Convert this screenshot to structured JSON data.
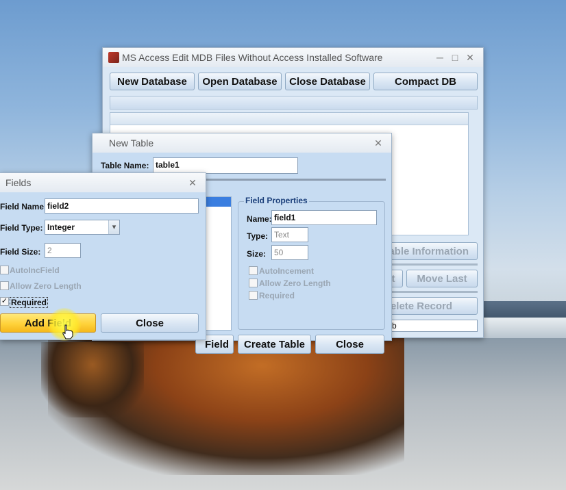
{
  "main_window": {
    "title": "MS Access Edit MDB Files Without Access Installed Software",
    "buttons": {
      "new_database": "New Database",
      "open_database": "Open Database",
      "close_database": "Close Database",
      "compact_db": "Compact DB"
    },
    "partial_buttons": {
      "table_information": "able Information",
      "prev": "t",
      "move_last": "Move Last",
      "delete_record": "elete Record"
    },
    "status_field": "b"
  },
  "new_table_window": {
    "title": "New Table",
    "table_name_label": "Table Name:",
    "table_name_value": "table1",
    "field_properties": {
      "title": "Field Properties",
      "name_label": "Name:",
      "name_value": "field1",
      "type_label": "Type:",
      "type_value": "Text",
      "size_label": "Size:",
      "size_value": "50",
      "autoincrement": "AutoIncement",
      "allow_zero_length": "Allow Zero Length",
      "required": "Required"
    },
    "buttons": {
      "add_field_partial": "Field",
      "create_table": "Create Table",
      "close": "Close"
    }
  },
  "fields_window": {
    "title": "Fields",
    "field_name_label": "Field Name:",
    "field_name_value": "field2",
    "field_type_label": "Field Type:",
    "field_type_value": "Integer",
    "field_size_label": "Field Size:",
    "field_size_value": "2",
    "autoinc": "AutoIncField",
    "allow_zero_length": "Allow Zero Length",
    "required": "Required",
    "required_checked": "✓",
    "buttons": {
      "add_field": "Add Field",
      "close": "Close"
    }
  },
  "titlebar_icons": {
    "minimize": "─",
    "maximize": "□",
    "close": "✕",
    "dropdown": "▾"
  },
  "colors": {
    "window_body": "#dbe8f5",
    "dialog_body": "#c7dcf2",
    "add_field_highlight": "#ffd23a"
  }
}
